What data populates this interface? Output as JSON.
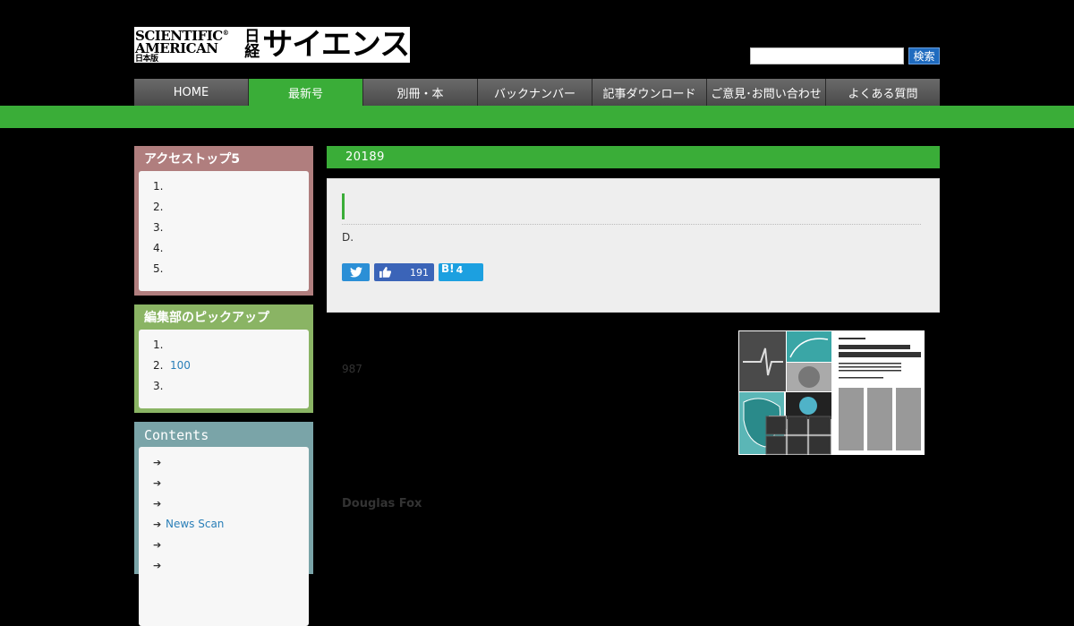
{
  "header": {
    "logo_sa_line1": "SCIENTIFIC",
    "logo_sa_line2": "AMERICAN",
    "logo_sa_small": "日本版",
    "logo_jp_small": "日経",
    "logo_jp_large": "サイエンス",
    "search_placeholder": "",
    "search_button": "検索"
  },
  "nav": {
    "items": [
      {
        "label": "HOME",
        "active": false
      },
      {
        "label": "最新号",
        "active": true
      },
      {
        "label": "別冊・本",
        "active": false
      },
      {
        "label": "バックナンバー",
        "active": false
      },
      {
        "label": "記事ダウンロード",
        "active": false
      },
      {
        "label": "ご意見･お問い合わせ",
        "active": false
      },
      {
        "label": "よくある質問",
        "active": false
      }
    ]
  },
  "sidebar": {
    "access_top": {
      "title": "アクセストップ5",
      "items": [
        "1.",
        "2.",
        "3.",
        "4.",
        "5."
      ]
    },
    "pickup": {
      "title": "編集部のピックアップ",
      "items": [
        {
          "num": "1.",
          "text": ""
        },
        {
          "num": "2.",
          "text": "100"
        },
        {
          "num": "3.",
          "text": ""
        }
      ]
    },
    "contents": {
      "title": "Contents",
      "items": [
        "",
        "",
        "",
        "News Scan",
        "",
        ""
      ]
    }
  },
  "main": {
    "issue_heading": "20189",
    "author_initial": "D.",
    "facebook_count": "191",
    "hatena_label": "B!",
    "hatena_count": "4",
    "page_number": "987",
    "author_name": "Douglas Fox"
  },
  "colors": {
    "green": "#3aad38",
    "access_top_bg": "#b07e7e",
    "pickup_bg": "#8ab464",
    "contents_bg": "#7aa4a8"
  }
}
